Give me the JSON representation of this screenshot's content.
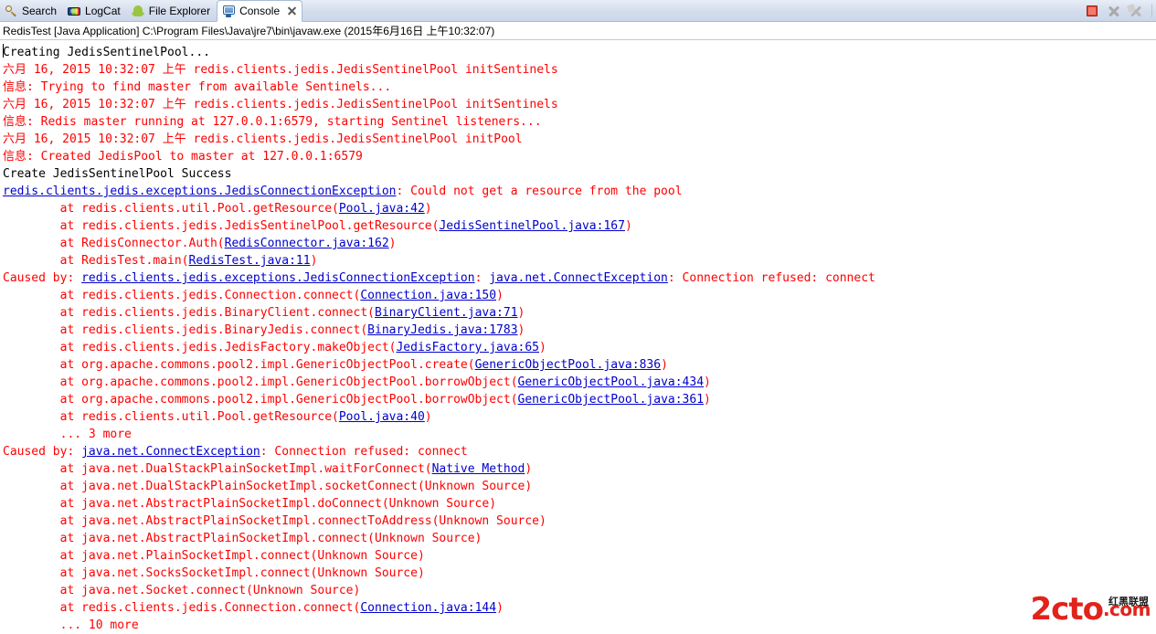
{
  "tabs": [
    {
      "label": "Search",
      "icon": "search-icon",
      "active": false,
      "closable": false
    },
    {
      "label": "LogCat",
      "icon": "logcat-icon",
      "active": false,
      "closable": false
    },
    {
      "label": "File Explorer",
      "icon": "android-icon",
      "active": false,
      "closable": false
    },
    {
      "label": "Console",
      "icon": "console-icon",
      "active": true,
      "closable": true
    }
  ],
  "toolbar": {
    "buttons": [
      {
        "name": "terminate-button",
        "icon": "stop-square-icon"
      },
      {
        "name": "remove-launch-button",
        "icon": "x-icon"
      },
      {
        "name": "remove-all-terminated-button",
        "icon": "x-multiple-icon"
      }
    ]
  },
  "process_info": "RedisTest [Java Application] C:\\Program Files\\Java\\jre7\\bin\\javaw.exe (2015年6月16日 上午10:32:07)",
  "colors": {
    "stdout": "#000000",
    "stderr": "#FF0000",
    "hyperlink": "#0000CC",
    "tabbar_bg": "#d4dded",
    "active_tab_bg": "#ffffff",
    "console_bg": "#ffffff"
  },
  "console_lines": [
    {
      "indent": 0,
      "segments": [
        {
          "t": "Creating JedisSentinelPool...",
          "s": "black"
        }
      ]
    },
    {
      "indent": 0,
      "segments": [
        {
          "t": "六月 16, 2015 10:32:07 上午 redis.clients.jedis.JedisSentinelPool initSentinels",
          "s": "red"
        }
      ]
    },
    {
      "indent": 0,
      "segments": [
        {
          "t": "信息: Trying to find master from available Sentinels...",
          "s": "red"
        }
      ]
    },
    {
      "indent": 0,
      "segments": [
        {
          "t": "六月 16, 2015 10:32:07 上午 redis.clients.jedis.JedisSentinelPool initSentinels",
          "s": "red"
        }
      ]
    },
    {
      "indent": 0,
      "segments": [
        {
          "t": "信息: Redis master running at 127.0.0.1:6579, starting Sentinel listeners...",
          "s": "red"
        }
      ]
    },
    {
      "indent": 0,
      "segments": [
        {
          "t": "六月 16, 2015 10:32:07 上午 redis.clients.jedis.JedisSentinelPool initPool",
          "s": "red"
        }
      ]
    },
    {
      "indent": 0,
      "segments": [
        {
          "t": "信息: Created JedisPool to master at 127.0.0.1:6579",
          "s": "red"
        }
      ]
    },
    {
      "indent": 0,
      "segments": [
        {
          "t": "Create JedisSentinelPool Success",
          "s": "black"
        }
      ]
    },
    {
      "indent": 0,
      "segments": [
        {
          "t": "redis.clients.jedis.exceptions.JedisConnectionException",
          "s": "link"
        },
        {
          "t": ": Could not get a resource from the pool",
          "s": "red"
        }
      ]
    },
    {
      "indent": 0,
      "segments": [
        {
          "t": "\tat redis.clients.util.Pool.getResource(",
          "s": "red"
        },
        {
          "t": "Pool.java:42",
          "s": "link"
        },
        {
          "t": ")",
          "s": "red"
        }
      ]
    },
    {
      "indent": 0,
      "segments": [
        {
          "t": "\tat redis.clients.jedis.JedisSentinelPool.getResource(",
          "s": "red"
        },
        {
          "t": "JedisSentinelPool.java:167",
          "s": "link"
        },
        {
          "t": ")",
          "s": "red"
        }
      ]
    },
    {
      "indent": 0,
      "segments": [
        {
          "t": "\tat RedisConnector.Auth(",
          "s": "red"
        },
        {
          "t": "RedisConnector.java:162",
          "s": "link"
        },
        {
          "t": ")",
          "s": "red"
        }
      ]
    },
    {
      "indent": 0,
      "segments": [
        {
          "t": "\tat RedisTest.main(",
          "s": "red"
        },
        {
          "t": "RedisTest.java:11",
          "s": "link"
        },
        {
          "t": ")",
          "s": "red"
        }
      ]
    },
    {
      "indent": 0,
      "segments": [
        {
          "t": "Caused by: ",
          "s": "red"
        },
        {
          "t": "redis.clients.jedis.exceptions.JedisConnectionException",
          "s": "link"
        },
        {
          "t": ": ",
          "s": "red"
        },
        {
          "t": "java.net.ConnectException",
          "s": "link"
        },
        {
          "t": ": Connection refused: connect",
          "s": "red"
        }
      ]
    },
    {
      "indent": 0,
      "segments": [
        {
          "t": "\tat redis.clients.jedis.Connection.connect(",
          "s": "red"
        },
        {
          "t": "Connection.java:150",
          "s": "link"
        },
        {
          "t": ")",
          "s": "red"
        }
      ]
    },
    {
      "indent": 0,
      "segments": [
        {
          "t": "\tat redis.clients.jedis.BinaryClient.connect(",
          "s": "red"
        },
        {
          "t": "BinaryClient.java:71",
          "s": "link"
        },
        {
          "t": ")",
          "s": "red"
        }
      ]
    },
    {
      "indent": 0,
      "segments": [
        {
          "t": "\tat redis.clients.jedis.BinaryJedis.connect(",
          "s": "red"
        },
        {
          "t": "BinaryJedis.java:1783",
          "s": "link"
        },
        {
          "t": ")",
          "s": "red"
        }
      ]
    },
    {
      "indent": 0,
      "segments": [
        {
          "t": "\tat redis.clients.jedis.JedisFactory.makeObject(",
          "s": "red"
        },
        {
          "t": "JedisFactory.java:65",
          "s": "link"
        },
        {
          "t": ")",
          "s": "red"
        }
      ]
    },
    {
      "indent": 0,
      "segments": [
        {
          "t": "\tat org.apache.commons.pool2.impl.GenericObjectPool.create(",
          "s": "red"
        },
        {
          "t": "GenericObjectPool.java:836",
          "s": "link"
        },
        {
          "t": ")",
          "s": "red"
        }
      ]
    },
    {
      "indent": 0,
      "segments": [
        {
          "t": "\tat org.apache.commons.pool2.impl.GenericObjectPool.borrowObject(",
          "s": "red"
        },
        {
          "t": "GenericObjectPool.java:434",
          "s": "link"
        },
        {
          "t": ")",
          "s": "red"
        }
      ]
    },
    {
      "indent": 0,
      "segments": [
        {
          "t": "\tat org.apache.commons.pool2.impl.GenericObjectPool.borrowObject(",
          "s": "red"
        },
        {
          "t": "GenericObjectPool.java:361",
          "s": "link"
        },
        {
          "t": ")",
          "s": "red"
        }
      ]
    },
    {
      "indent": 0,
      "segments": [
        {
          "t": "\tat redis.clients.util.Pool.getResource(",
          "s": "red"
        },
        {
          "t": "Pool.java:40",
          "s": "link"
        },
        {
          "t": ")",
          "s": "red"
        }
      ]
    },
    {
      "indent": 0,
      "segments": [
        {
          "t": "\t... 3 more",
          "s": "red"
        }
      ]
    },
    {
      "indent": 0,
      "segments": [
        {
          "t": "Caused by: ",
          "s": "red"
        },
        {
          "t": "java.net.ConnectException",
          "s": "link"
        },
        {
          "t": ": Connection refused: connect",
          "s": "red"
        }
      ]
    },
    {
      "indent": 0,
      "segments": [
        {
          "t": "\tat java.net.DualStackPlainSocketImpl.waitForConnect(",
          "s": "red"
        },
        {
          "t": "Native Method",
          "s": "link"
        },
        {
          "t": ")",
          "s": "red"
        }
      ]
    },
    {
      "indent": 0,
      "segments": [
        {
          "t": "\tat java.net.DualStackPlainSocketImpl.socketConnect(Unknown Source)",
          "s": "red"
        }
      ]
    },
    {
      "indent": 0,
      "segments": [
        {
          "t": "\tat java.net.AbstractPlainSocketImpl.doConnect(Unknown Source)",
          "s": "red"
        }
      ]
    },
    {
      "indent": 0,
      "segments": [
        {
          "t": "\tat java.net.AbstractPlainSocketImpl.connectToAddress(Unknown Source)",
          "s": "red"
        }
      ]
    },
    {
      "indent": 0,
      "segments": [
        {
          "t": "\tat java.net.AbstractPlainSocketImpl.connect(Unknown Source)",
          "s": "red"
        }
      ]
    },
    {
      "indent": 0,
      "segments": [
        {
          "t": "\tat java.net.PlainSocketImpl.connect(Unknown Source)",
          "s": "red"
        }
      ]
    },
    {
      "indent": 0,
      "segments": [
        {
          "t": "\tat java.net.SocksSocketImpl.connect(Unknown Source)",
          "s": "red"
        }
      ]
    },
    {
      "indent": 0,
      "segments": [
        {
          "t": "\tat java.net.Socket.connect(Unknown Source)",
          "s": "red"
        }
      ]
    },
    {
      "indent": 0,
      "segments": [
        {
          "t": "\tat redis.clients.jedis.Connection.connect(",
          "s": "red"
        },
        {
          "t": "Connection.java:144",
          "s": "link"
        },
        {
          "t": ")",
          "s": "red"
        }
      ]
    },
    {
      "indent": 0,
      "segments": [
        {
          "t": "\t... 10 more",
          "s": "red"
        }
      ]
    }
  ],
  "watermark": {
    "main": "2cto",
    "suffix": ".com",
    "chinese": "红黑联盟"
  }
}
